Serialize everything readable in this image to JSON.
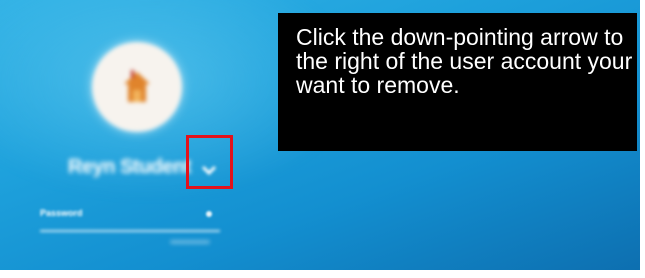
{
  "login_screen": {
    "user_name": "Reyn Student",
    "password_label": "Password",
    "avatar_icon": "house-icon",
    "dropdown_icon": "chevron-down-icon"
  },
  "callout": {
    "text": "Click the down-pointing arrow to the right of the user account your want to remove."
  },
  "colors": {
    "highlight": "#e3121c",
    "background_accent": "#1ea1dc",
    "callout_background": "#000000"
  }
}
